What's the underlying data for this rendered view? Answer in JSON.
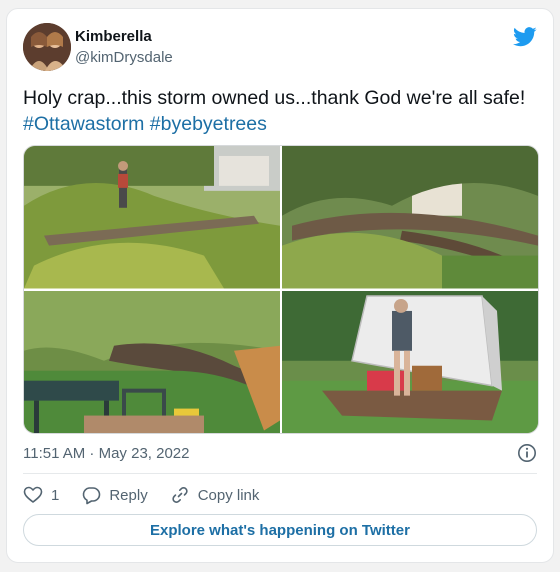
{
  "user": {
    "name": "Kimberella",
    "handle": "@kimDrysdale"
  },
  "tweet": {
    "text": "Holy crap...this storm owned us...thank God we're all safe!",
    "hashtags": [
      "#Ottawastorm",
      "#byebyetrees"
    ],
    "timestamp": "11:51 AM · May 23, 2022"
  },
  "media": {
    "photo_count": 4
  },
  "actions": {
    "likes": "1",
    "reply_label": "Reply",
    "copy_link_label": "Copy link"
  },
  "explore_label": "Explore what's happening on Twitter",
  "icons": {
    "brand": "twitter-bird-icon",
    "info": "info-icon",
    "like": "heart-icon",
    "reply": "reply-bubble-icon",
    "copy": "link-icon"
  },
  "colors": {
    "brand_blue": "#1d9bf0",
    "link_blue": "#1d6fa5",
    "text": "#0f1419",
    "muted": "#536471"
  }
}
